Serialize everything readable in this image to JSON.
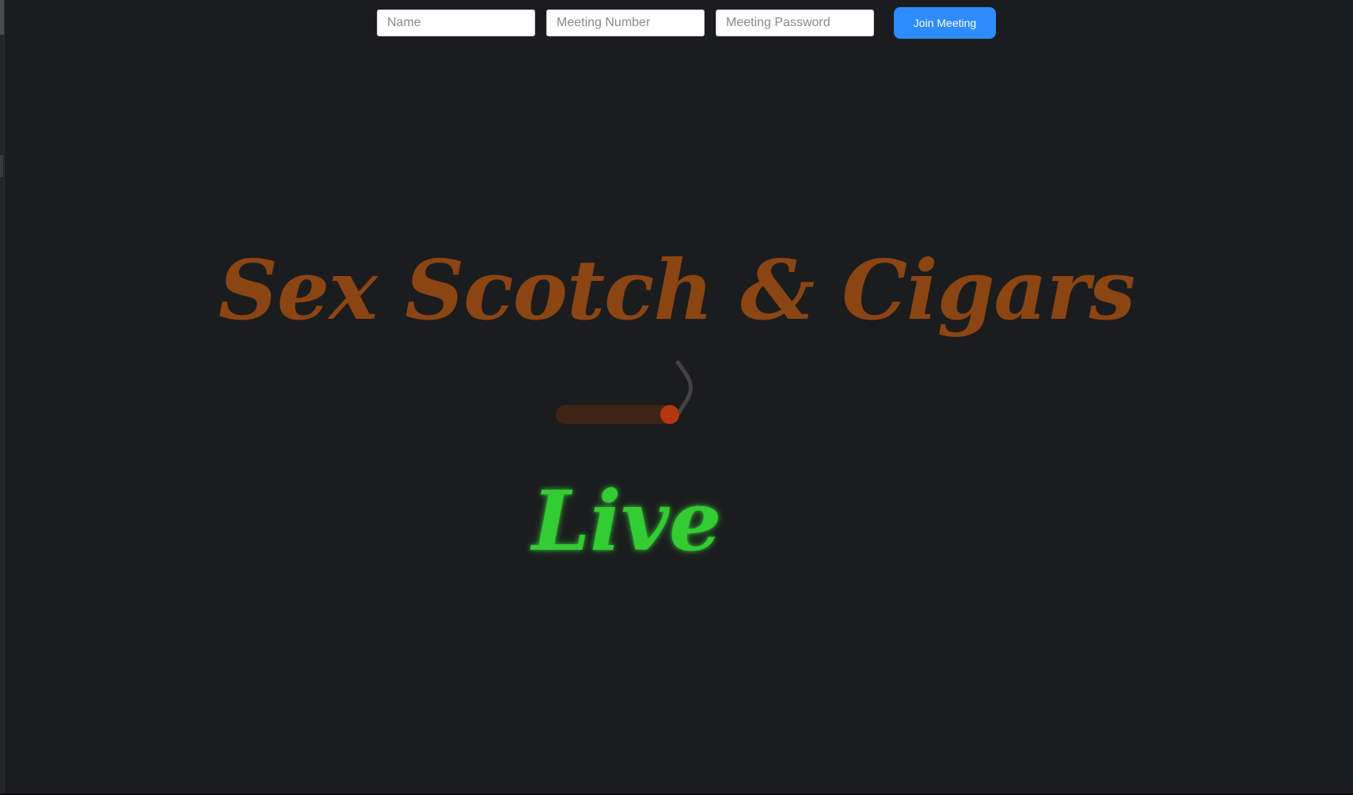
{
  "join_form": {
    "name_placeholder": "Name",
    "meeting_number_placeholder": "Meeting Number",
    "meeting_password_placeholder": "Meeting Password",
    "join_button_label": "Join Meeting"
  },
  "hero": {
    "title": "Sex Scotch & Cigars",
    "live_label": "Live"
  },
  "colors": {
    "background": "#1b1c1e",
    "title": "#8b4513",
    "live": "#33cc33",
    "button": "#2d8cff",
    "cigar_body": "#3d2414",
    "cigar_ember": "#b5380d",
    "smoke": "#4a4a4c"
  },
  "icons": {
    "cigar": "lit-cigar-icon"
  }
}
